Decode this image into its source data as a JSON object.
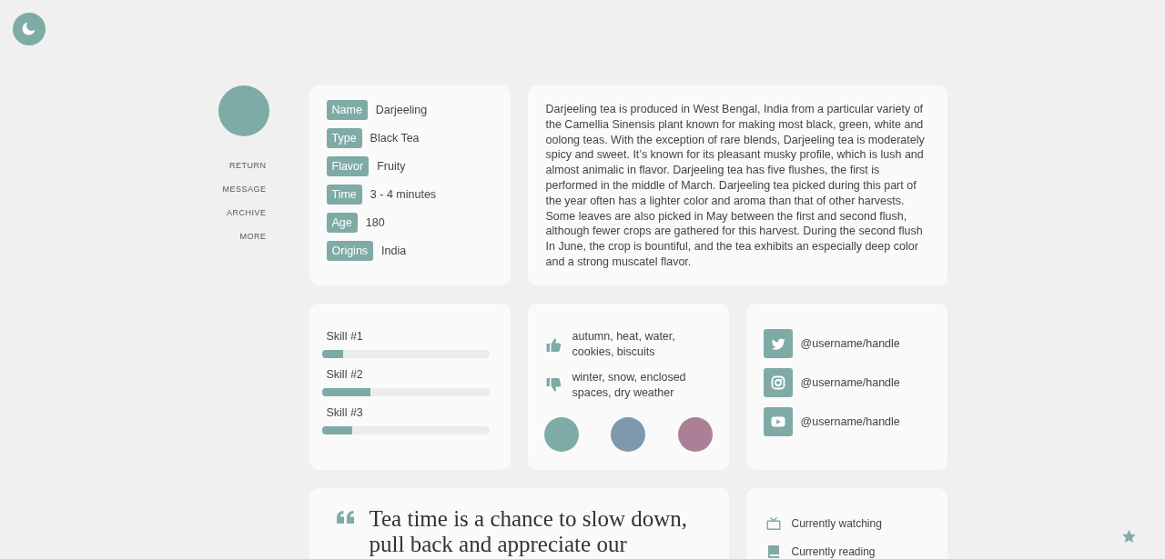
{
  "sidebar": {
    "nav": [
      {
        "label": "RETURN"
      },
      {
        "label": "MESSAGE"
      },
      {
        "label": "ARCHIVE"
      },
      {
        "label": "MORE"
      }
    ]
  },
  "details": [
    {
      "label": "Name",
      "value": "Darjeeling"
    },
    {
      "label": "Type",
      "value": "Black Tea"
    },
    {
      "label": "Flavor",
      "value": "Fruity"
    },
    {
      "label": "Time",
      "value": "3 - 4 minutes"
    },
    {
      "label": "Age",
      "value": "180"
    },
    {
      "label": "Origins",
      "value": "India"
    }
  ],
  "description": "Darjeeling tea is produced in West Bengal, India from a particular variety of the Camellia Sinensis plant known for making most black, green, white and oolong teas. With the exception of rare blends, Darjeeling tea is moderately spicy and sweet. It’s known for its pleasant musky profile, which is lush and almost animalic in flavor. Darjeeling tea has five flushes, the first is performed in the middle of March. Darjeeling tea picked during this part of the year often has a lighter color and aroma than that of other harvests. Some leaves are also picked in May between the first and second flush, although fewer crops are gathered for this harvest. During the second flush In June, the crop is bountiful, and the tea exhibits an especially deep color and a strong muscatel flavor.",
  "skills": [
    {
      "label": "Skill #1",
      "level": 0.125
    },
    {
      "label": "Skill #2",
      "level": 0.29
    },
    {
      "label": "Skill #3",
      "level": 0.18
    }
  ],
  "preferences": [
    {
      "kind": "like",
      "text": "autumn, heat, water, cookies, biscuits"
    },
    {
      "kind": "dislike",
      "text": "winter, snow, enclosed spaces, dry weather"
    }
  ],
  "swatches": [
    {
      "color": "#7eaba5"
    },
    {
      "color": "#7f98ab"
    },
    {
      "color": "#ad7f97"
    }
  ],
  "social": [
    {
      "kind": "bird",
      "handle": "@username/handle"
    },
    {
      "kind": "camera",
      "handle": "@username/handle"
    },
    {
      "kind": "play",
      "handle": "@username/handle"
    }
  ],
  "quote": {
    "text": "Tea time is a chance to slow down, pull back and appreciate our"
  },
  "activity": [
    {
      "kind": "watching",
      "text": "Currently watching"
    },
    {
      "kind": "reading",
      "text": "Currently reading"
    }
  ]
}
